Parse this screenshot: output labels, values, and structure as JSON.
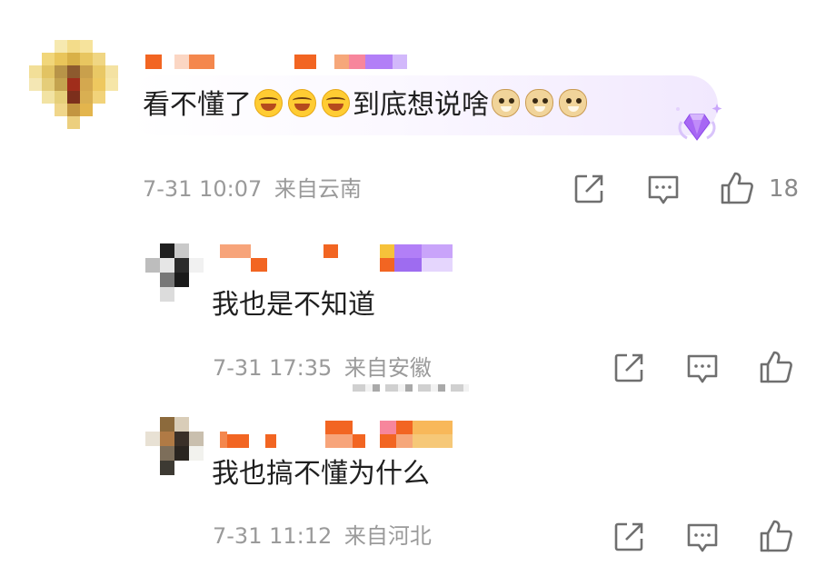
{
  "comments": [
    {
      "text_before": "看不懂了",
      "emoji_laugh": [
        "laugh-emoji",
        "laugh-emoji",
        "laugh-emoji"
      ],
      "text_after": "到底想说啥",
      "emoji_doge": [
        "doge-emoji",
        "doge-emoji",
        "doge-emoji"
      ],
      "badge_icon": "purple-gem-badge-icon",
      "date_time": "7-31 10:07",
      "location": "来自云南",
      "like_count": "18"
    },
    {
      "text": "我也是不知道",
      "date_time": "7-31 17:35",
      "location": "来自安徽"
    },
    {
      "text": "我也搞不懂为什么",
      "date_time": "7-31 11:12",
      "location": "来自河北"
    }
  ],
  "icons": {
    "share": "share-icon",
    "reply": "comment-icon",
    "like": "thumbs-up-icon"
  },
  "colors": {
    "mosaic_orange": "#f26522",
    "mosaic_purple": "#a66cf5",
    "meta_gray": "#9a9a9a",
    "icon_gray": "#6f6f6f"
  }
}
